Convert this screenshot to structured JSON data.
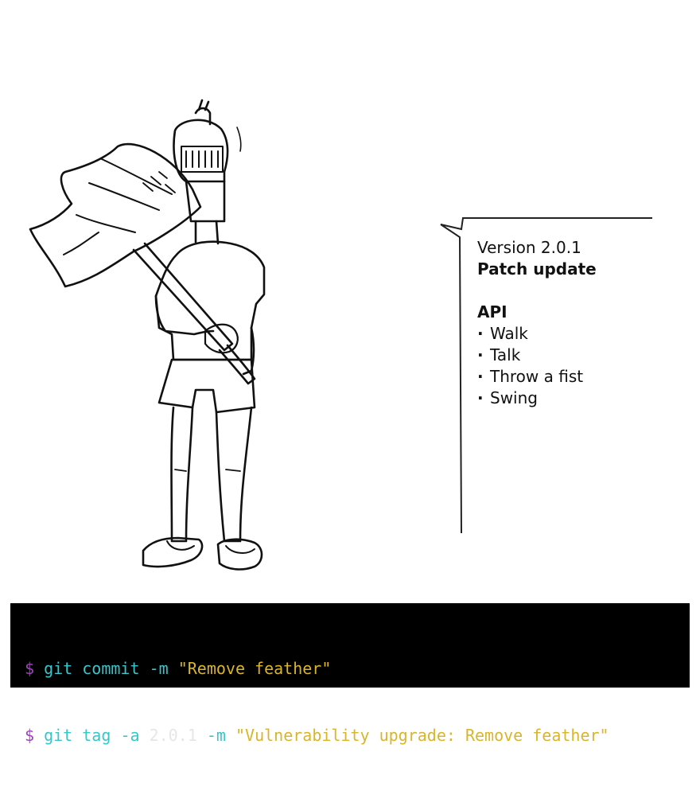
{
  "scene": {
    "illustration": "knight-with-battle-axe"
  },
  "speech_bubble": {
    "version_line": "Version 2.0.1",
    "update_type": "Patch update",
    "api_heading": "API",
    "api_items": [
      "Walk",
      "Talk",
      "Throw a fist",
      "Swing"
    ]
  },
  "terminal": {
    "colors": {
      "background": "#000000",
      "prompt": "#a23fbf",
      "command": "#36c6cc",
      "argument": "#e6e6e6",
      "string": "#d9b52c"
    },
    "lines": [
      {
        "prompt": "$",
        "git": "git",
        "subcommand": "commit",
        "flag1": "-m",
        "arg": "",
        "flag2": "",
        "message": "\"Remove feather\""
      },
      {
        "prompt": "$",
        "git": "git",
        "subcommand": "tag",
        "flag1": "-a",
        "arg": "2.0.1",
        "flag2": "-m",
        "message": "\"Vulnerability upgrade: Remove feather\""
      }
    ]
  }
}
